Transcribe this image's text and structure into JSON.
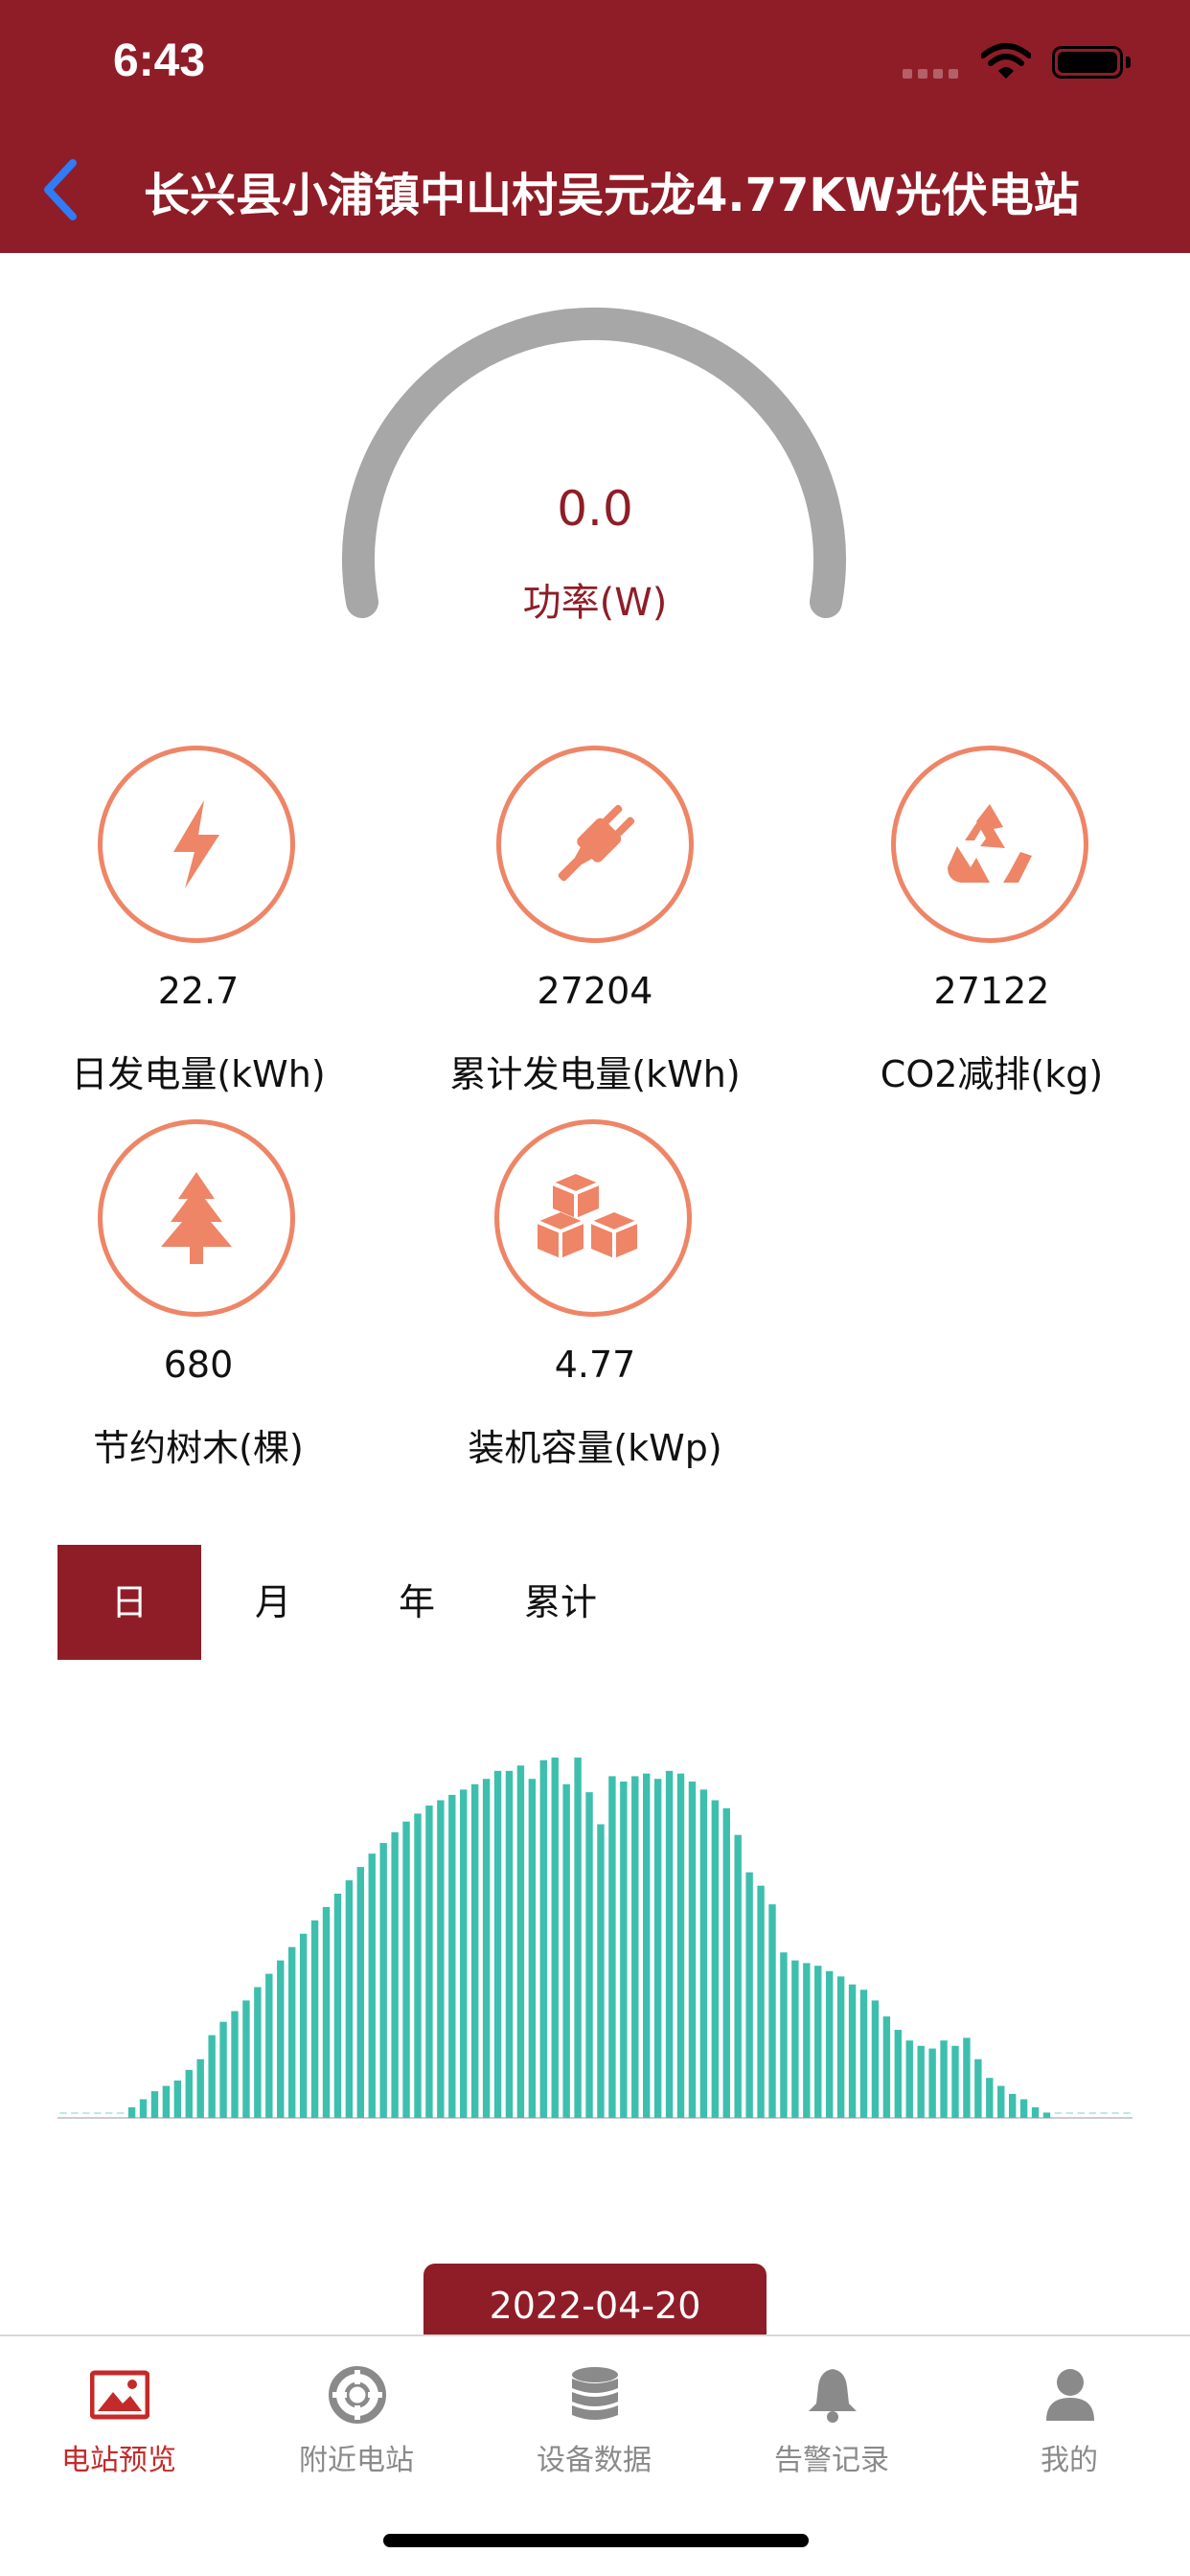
{
  "status_bar": {
    "time": "6:43"
  },
  "header": {
    "title": "长兴县小浦镇中山村吴元龙4.77KW光伏电站"
  },
  "gauge": {
    "value": "0.0",
    "label": "功率(W)"
  },
  "metrics": [
    {
      "icon": "lightning-icon",
      "value": "22.7",
      "label": "日发电量(kWh)"
    },
    {
      "icon": "plug-icon",
      "value": "27204",
      "label": "累计发电量(kWh)"
    },
    {
      "icon": "recycle-icon",
      "value": "27122",
      "label": "CO2减排(kg)"
    },
    {
      "icon": "tree-icon",
      "value": "680",
      "label": "节约树木(棵)"
    },
    {
      "icon": "boxes-icon",
      "value": "4.77",
      "label": "装机容量(kWp)"
    }
  ],
  "tabs": [
    {
      "label": "日",
      "active": true
    },
    {
      "label": "月",
      "active": false
    },
    {
      "label": "年",
      "active": false
    },
    {
      "label": "累计",
      "active": false
    }
  ],
  "chart_data": {
    "type": "bar",
    "color": "#3dbfae",
    "values": [
      0,
      0,
      0,
      0,
      0,
      0,
      0.2,
      0.35,
      0.5,
      0.6,
      0.7,
      0.9,
      1.1,
      1.55,
      1.8,
      2.0,
      2.2,
      2.45,
      2.7,
      2.95,
      3.2,
      3.45,
      3.7,
      3.95,
      4.2,
      4.45,
      4.7,
      4.95,
      5.15,
      5.35,
      5.55,
      5.7,
      5.85,
      5.95,
      6.05,
      6.15,
      6.25,
      6.35,
      6.5,
      6.5,
      6.6,
      6.35,
      6.7,
      6.75,
      6.25,
      6.75,
      6.1,
      5.5,
      6.4,
      6.3,
      6.4,
      6.45,
      6.35,
      6.5,
      6.45,
      6.3,
      6.15,
      5.95,
      5.8,
      5.3,
      4.6,
      4.35,
      4.0,
      3.1,
      2.95,
      2.9,
      2.85,
      2.75,
      2.65,
      2.5,
      2.4,
      2.2,
      1.9,
      1.65,
      1.45,
      1.35,
      1.3,
      1.45,
      1.35,
      1.5,
      1.1,
      0.75,
      0.6,
      0.45,
      0.35,
      0.2,
      0.1,
      0,
      0,
      0,
      0,
      0,
      0,
      0
    ],
    "ylim": [
      0,
      7
    ]
  },
  "date_button": {
    "label": "2022-04-20"
  },
  "tabbar": [
    {
      "label": "电站预览",
      "icon": "image-icon",
      "active": true
    },
    {
      "label": "附近电站",
      "icon": "lifebuoy-icon",
      "active": false
    },
    {
      "label": "设备数据",
      "icon": "database-icon",
      "active": false
    },
    {
      "label": "告警记录",
      "icon": "bell-icon",
      "active": false
    },
    {
      "label": "我的",
      "icon": "user-icon",
      "active": false
    }
  ],
  "colors": {
    "brand": "#8f1d27",
    "accent": "#ee8566",
    "chart": "#3dbfae",
    "tab_active": "#c52a2a"
  }
}
